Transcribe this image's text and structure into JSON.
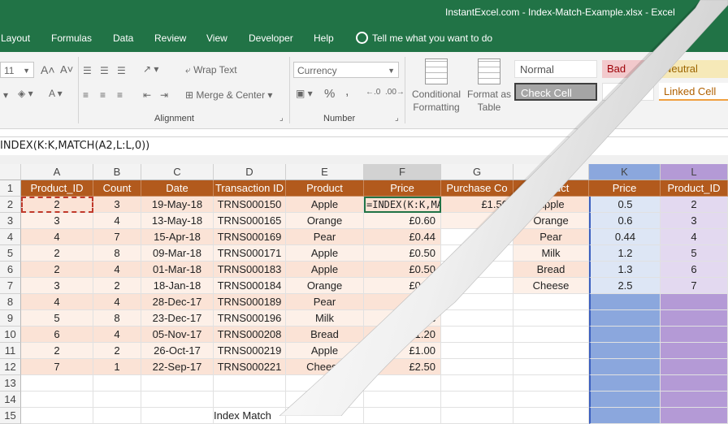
{
  "window": {
    "title": "InstantExcel.com - Index-Match-Example.xlsx  -  Excel"
  },
  "ribbon_tabs": [
    "Layout",
    "Formulas",
    "Data",
    "Review",
    "View",
    "Developer",
    "Help"
  ],
  "tell_me": "Tell me what you want to do",
  "ribbon": {
    "font_size": "11",
    "wrap_text": "Wrap Text",
    "merge_center": "Merge & Center",
    "number_format": "Currency",
    "conditional_formatting": "Conditional Formatting",
    "format_as_table": "Format as Table",
    "styles": {
      "normal": "Normal",
      "bad": "Bad",
      "neutral": "Neutral",
      "check_cell": "Check Cell",
      "linked_cell": "Linked Cell"
    },
    "groups": {
      "alignment": "Alignment",
      "number": "Number"
    },
    "percent": "%",
    "comma": ","
  },
  "formula_bar": {
    "formula": "INDEX(K:K,MATCH(A2,L:L,0))"
  },
  "columns": [
    "A",
    "B",
    "C",
    "D",
    "E",
    "F",
    "G",
    "J",
    "K",
    "L"
  ],
  "row_numbers": [
    "1",
    "2",
    "3",
    "4",
    "5",
    "6",
    "7",
    "8",
    "9",
    "10",
    "11",
    "12",
    "13",
    "14",
    "15"
  ],
  "headers": {
    "A": "Product_ID",
    "B": "Count",
    "C": "Date",
    "D": "Transaction ID",
    "E": "Product",
    "F": "Price",
    "G": "Purchase Co",
    "J": "Product",
    "K": "Price",
    "L": "Product_ID"
  },
  "rows": [
    {
      "A": "2",
      "B": "3",
      "C": "19-May-18",
      "D": "TRNS000150",
      "E": "Apple",
      "F": "=INDEX(K:K,MA",
      "G": "£1.50",
      "J": "Apple",
      "K": "0.5",
      "L": "2"
    },
    {
      "A": "3",
      "B": "4",
      "C": "13-May-18",
      "D": "TRNS000165",
      "E": "Orange",
      "F": "£0.60",
      "G": "£",
      "J": "Orange",
      "K": "0.6",
      "L": "3"
    },
    {
      "A": "4",
      "B": "7",
      "C": "15-Apr-18",
      "D": "TRNS000169",
      "E": "Pear",
      "F": "£0.44",
      "G": "",
      "J": "Pear",
      "K": "0.44",
      "L": "4"
    },
    {
      "A": "2",
      "B": "8",
      "C": "09-Mar-18",
      "D": "TRNS000171",
      "E": "Apple",
      "F": "£0.50",
      "G": "",
      "J": "Milk",
      "K": "1.2",
      "L": "5"
    },
    {
      "A": "2",
      "B": "4",
      "C": "01-Mar-18",
      "D": "TRNS000183",
      "E": "Apple",
      "F": "£0.50",
      "G": "",
      "J": "Bread",
      "K": "1.3",
      "L": "6"
    },
    {
      "A": "3",
      "B": "2",
      "C": "18-Jan-18",
      "D": "TRNS000184",
      "E": "Orange",
      "F": "£0.60",
      "G": "",
      "J": "Cheese",
      "K": "2.5",
      "L": "7"
    },
    {
      "A": "4",
      "B": "4",
      "C": "28-Dec-17",
      "D": "TRNS000189",
      "E": "Pear",
      "F": "£0",
      "G": "",
      "J": "",
      "K": "",
      "L": ""
    },
    {
      "A": "5",
      "B": "8",
      "C": "23-Dec-17",
      "D": "TRNS000196",
      "E": "Milk",
      "F": "£",
      "G": "",
      "J": "",
      "K": "",
      "L": ""
    },
    {
      "A": "6",
      "B": "4",
      "C": "05-Nov-17",
      "D": "TRNS000208",
      "E": "Bread",
      "F": "£1.20",
      "G": "",
      "J": "",
      "K": "",
      "L": ""
    },
    {
      "A": "2",
      "B": "2",
      "C": "26-Oct-17",
      "D": "TRNS000219",
      "E": "Apple",
      "F": "£1.00",
      "G": "",
      "J": "",
      "K": "",
      "L": ""
    },
    {
      "A": "7",
      "B": "1",
      "C": "22-Sep-17",
      "D": "TRNS000221",
      "E": "Cheese",
      "F": "£2.50",
      "G": "",
      "J": "",
      "K": "",
      "L": ""
    }
  ],
  "row15_text": "Index Match",
  "colors": {
    "excel_green": "#217346",
    "table_header": "#b25a1d",
    "lookup_price_col": "#8ba7dd",
    "lookup_id_col": "#b49ad6"
  }
}
